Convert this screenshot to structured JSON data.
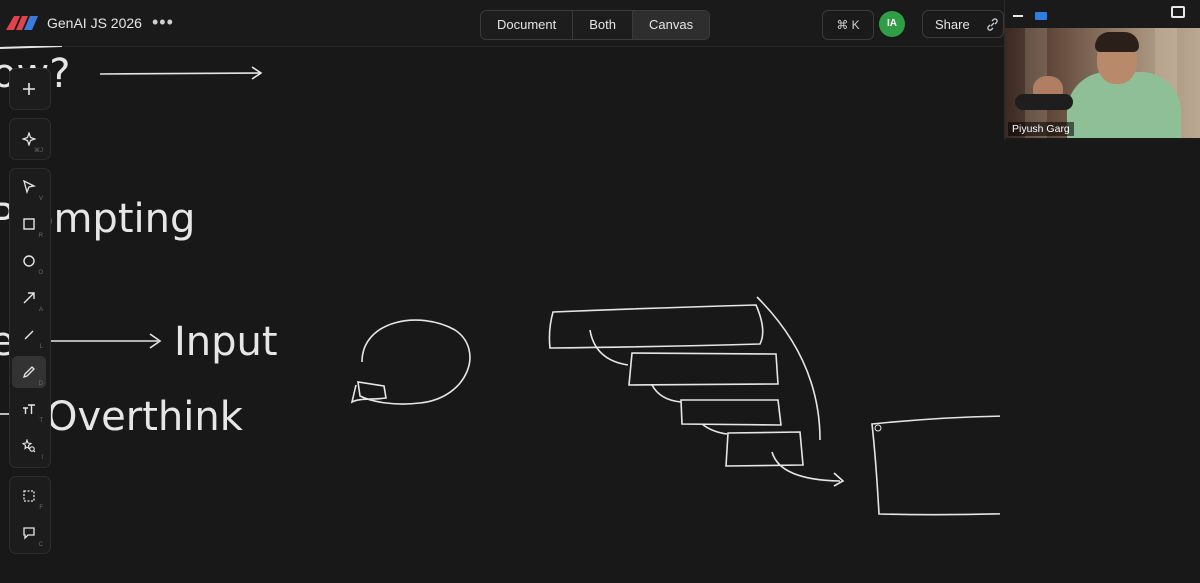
{
  "app": {
    "title": "GenAI JS 2026",
    "more": "•••"
  },
  "view_toggle": {
    "document": "Document",
    "both": "Both",
    "canvas": "Canvas"
  },
  "command": {
    "shortcut": "⌘ K"
  },
  "user": {
    "initials": "IA"
  },
  "share": {
    "label": "Share"
  },
  "video": {
    "speaker": "Piyush Garg"
  },
  "canvas": {
    "text_items": [
      "ow?",
      "Prompting",
      "e",
      "Input",
      "Overthink"
    ]
  },
  "toolbar": {
    "tools": [
      {
        "name": "add",
        "key": ""
      },
      {
        "name": "ai-magic",
        "key": "⌘J"
      },
      {
        "name": "select",
        "key": "V"
      },
      {
        "name": "rectangle",
        "key": "R"
      },
      {
        "name": "ellipse",
        "key": "O"
      },
      {
        "name": "arrow",
        "key": "A"
      },
      {
        "name": "line",
        "key": "L"
      },
      {
        "name": "pencil",
        "key": "D"
      },
      {
        "name": "text",
        "key": "T"
      },
      {
        "name": "shape-search",
        "key": "I"
      },
      {
        "name": "frame",
        "key": "F"
      },
      {
        "name": "comment",
        "key": "C"
      }
    ]
  }
}
